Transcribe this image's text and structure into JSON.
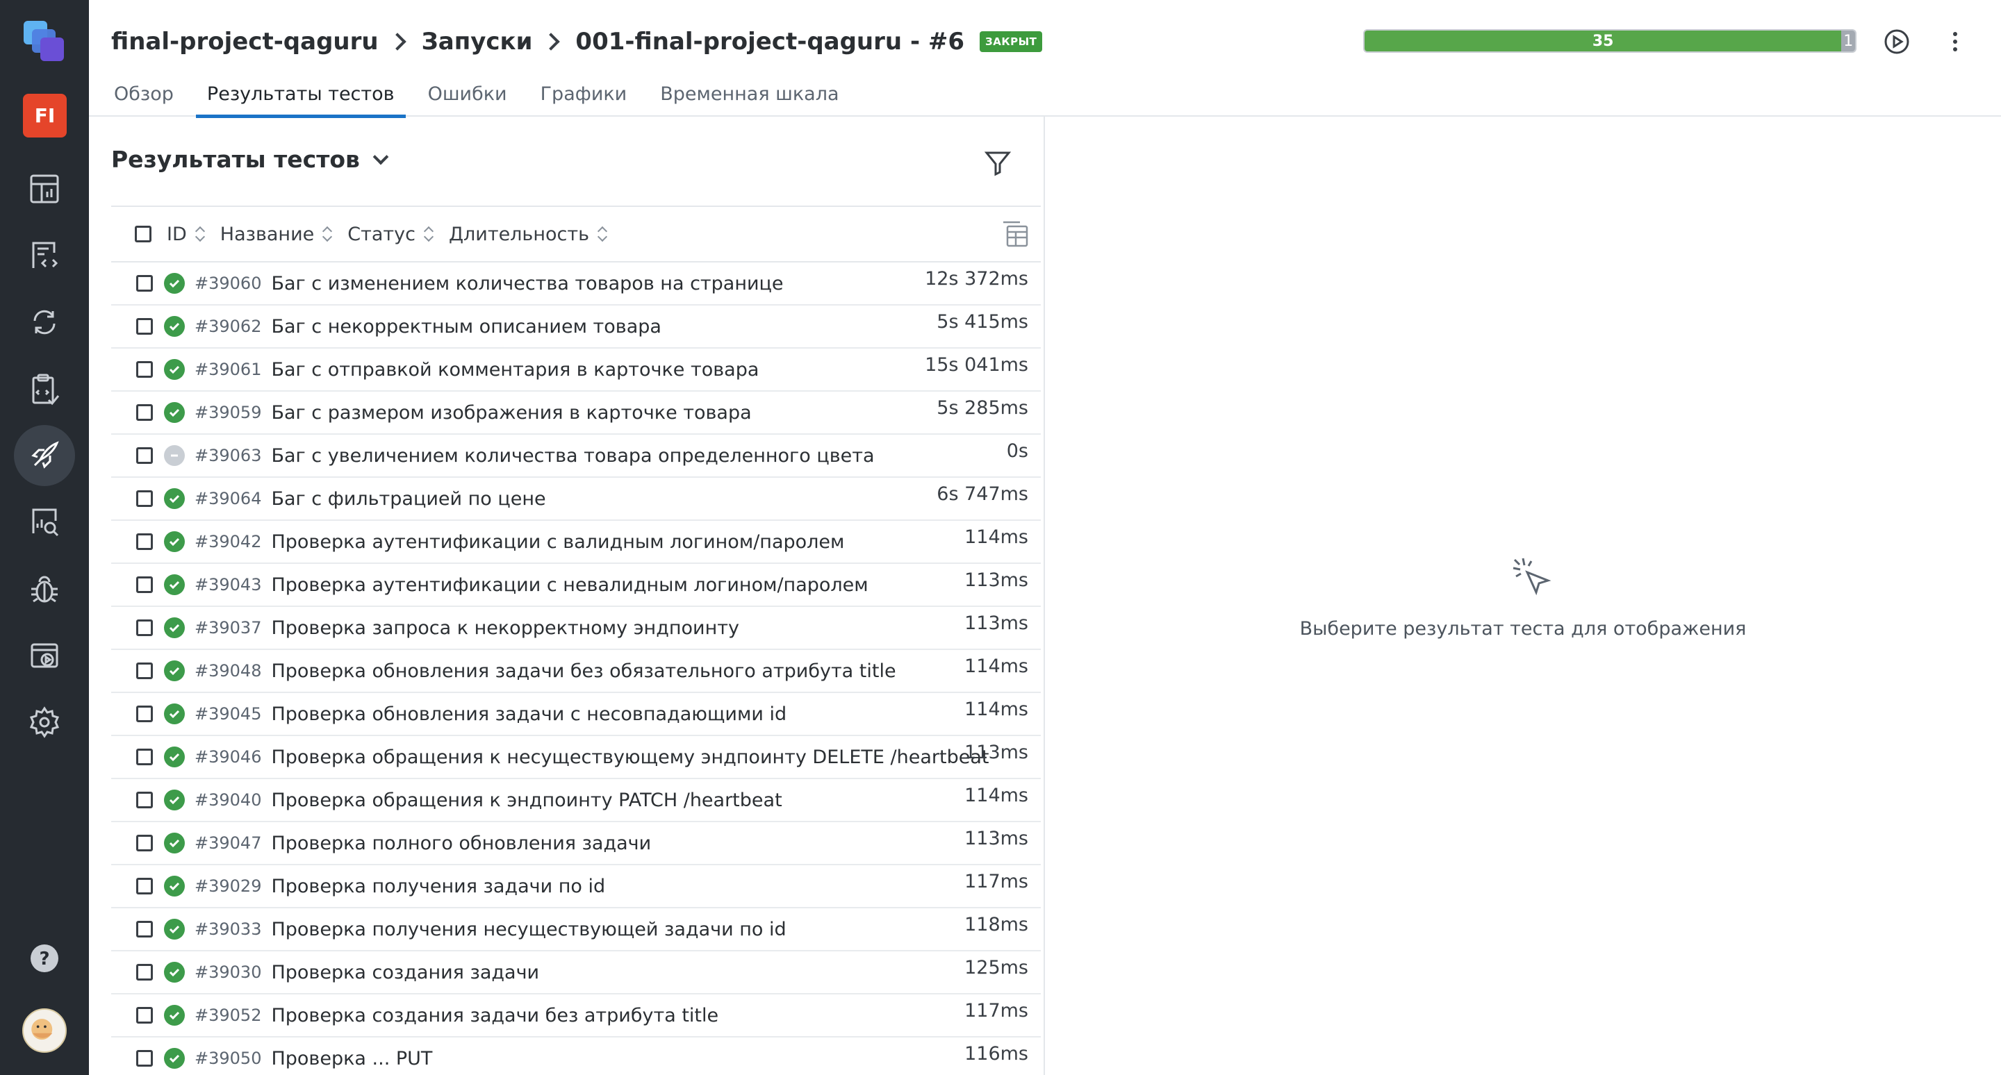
{
  "sidebar": {
    "project_badge": "FI",
    "active_item": "launches",
    "items": [
      "dashboards-icon",
      "test-cases-icon",
      "launches-sync-icon",
      "test-plans-icon",
      "launches-icon",
      "analytics-icon",
      "defects-icon",
      "jobs-icon",
      "settings-icon"
    ],
    "help_icon": "help-icon"
  },
  "header": {
    "breadcrumbs": [
      "final-project-qaguru",
      "Запуски",
      "001-final-project-qaguru - #6"
    ],
    "status_badge": "ЗАКРЫТ",
    "tabs": [
      "Обзор",
      "Результаты тестов",
      "Ошибки",
      "Графики",
      "Временная шкала"
    ],
    "active_tab": 1,
    "progress": {
      "passed": 35,
      "skipped": 1,
      "passed_color": "#57a64a",
      "skipped_color": "#a4aab2"
    }
  },
  "results": {
    "title": "Результаты тестов",
    "columns": {
      "id": "ID",
      "name": "Название",
      "status": "Статус",
      "duration": "Длительность"
    },
    "rows": [
      {
        "id": "#39060",
        "name": "Баг с изменением количества товаров на странице",
        "status": "passed",
        "duration": "12s 372ms"
      },
      {
        "id": "#39062",
        "name": "Баг с некорректным описанием товара",
        "status": "passed",
        "duration": "5s 415ms"
      },
      {
        "id": "#39061",
        "name": "Баг с отправкой комментария в карточке товара",
        "status": "passed",
        "duration": "15s 041ms"
      },
      {
        "id": "#39059",
        "name": "Баг с размером изображения в карточке товара",
        "status": "passed",
        "duration": "5s 285ms"
      },
      {
        "id": "#39063",
        "name": "Баг с увеличением количества товара определенного цвета",
        "status": "skipped",
        "duration": "0s"
      },
      {
        "id": "#39064",
        "name": "Баг с фильтрацией по цене",
        "status": "passed",
        "duration": "6s 747ms"
      },
      {
        "id": "#39042",
        "name": "Проверка аутентификации с валидным логином/паролем",
        "status": "passed",
        "duration": "114ms"
      },
      {
        "id": "#39043",
        "name": "Проверка аутентификации с невалидным логином/паролем",
        "status": "passed",
        "duration": "113ms"
      },
      {
        "id": "#39037",
        "name": "Проверка запроса к некорректному эндпоинту",
        "status": "passed",
        "duration": "113ms"
      },
      {
        "id": "#39048",
        "name": "Проверка обновления задачи без обязательного атрибута title",
        "status": "passed",
        "duration": "114ms"
      },
      {
        "id": "#39045",
        "name": "Проверка обновления задачи с несовпадающими id",
        "status": "passed",
        "duration": "114ms"
      },
      {
        "id": "#39046",
        "name": "Проверка обращения к несуществующему эндпоинту DELETE /heartbeat",
        "status": "passed",
        "duration": "113ms"
      },
      {
        "id": "#39040",
        "name": "Проверка обращения к эндпоинту PATCH /heartbeat",
        "status": "passed",
        "duration": "114ms"
      },
      {
        "id": "#39047",
        "name": "Проверка полного обновления задачи",
        "status": "passed",
        "duration": "113ms"
      },
      {
        "id": "#39029",
        "name": "Проверка получения задачи по id",
        "status": "passed",
        "duration": "117ms"
      },
      {
        "id": "#39033",
        "name": "Проверка получения несуществующей задачи по id",
        "status": "passed",
        "duration": "118ms"
      },
      {
        "id": "#39030",
        "name": "Проверка создания задачи",
        "status": "passed",
        "duration": "125ms"
      },
      {
        "id": "#39052",
        "name": "Проверка создания задачи без атрибута title",
        "status": "passed",
        "duration": "117ms"
      },
      {
        "id": "#39050",
        "name": "Проверка ... PUT",
        "status": "passed",
        "duration": "116ms"
      }
    ]
  },
  "detail": {
    "empty_text": "Выберите результат теста для отображения"
  }
}
